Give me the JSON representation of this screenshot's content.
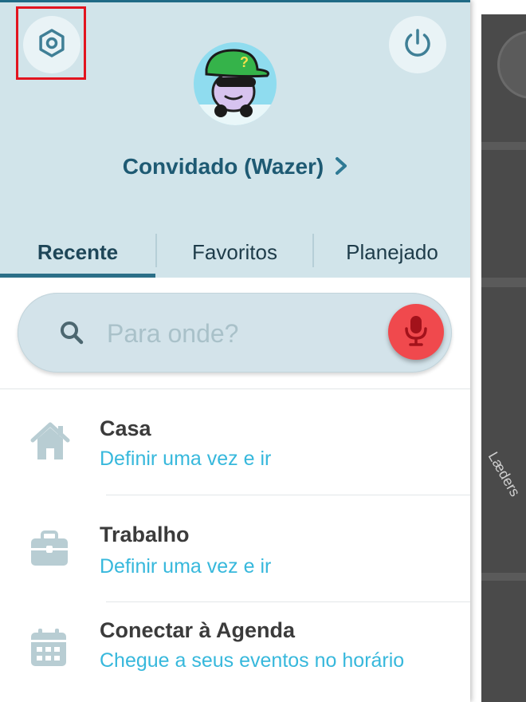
{
  "header": {
    "username": "Convidado (Wazer)"
  },
  "tabs": [
    {
      "label": "Recente"
    },
    {
      "label": "Favoritos"
    },
    {
      "label": "Planejado"
    }
  ],
  "search": {
    "placeholder": "Para onde?"
  },
  "items": [
    {
      "title": "Casa",
      "subtitle": "Definir uma vez e ir",
      "icon": "home-icon"
    },
    {
      "title": "Trabalho",
      "subtitle": "Definir uma vez e ir",
      "icon": "briefcase-icon"
    },
    {
      "title": "Conectar à Agenda",
      "subtitle": "Chegue a seus eventos no horário",
      "icon": "calendar-icon"
    }
  ],
  "map": {
    "street_label": "Læders"
  },
  "colors": {
    "header_bg": "#d1e4ea",
    "accent": "#2b6f88",
    "mic": "#f0494d",
    "link": "#37b8dc",
    "highlight": "#e2141f"
  }
}
